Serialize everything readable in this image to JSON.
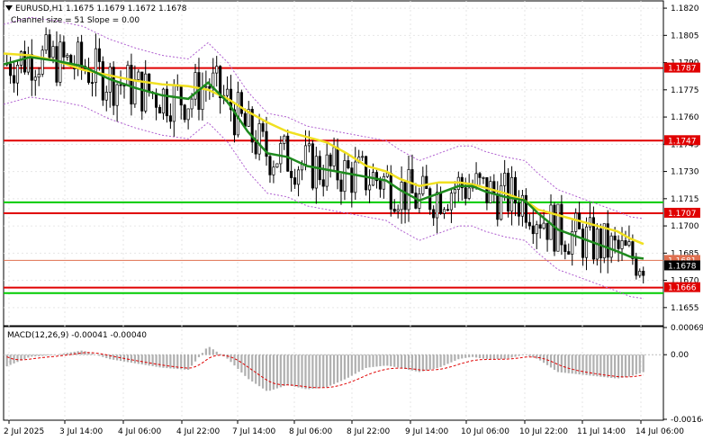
{
  "header": {
    "symbol_line": "EURUSD,H1  1.1675 1.1679 1.1672 1.1678",
    "channel_line": "Channel size = 51 Slope = 0.00"
  },
  "macd": {
    "label": "MACD(12,26,9) -0.00041 -0.00040",
    "axis_ticks": [
      "0.00069",
      "0.00",
      "-0.00164"
    ]
  },
  "chart_data": {
    "type": "candlestick",
    "symbol": "EURUSD",
    "timeframe": "H1",
    "price_axis": {
      "ticks": [
        1.182,
        1.1805,
        1.179,
        1.1775,
        1.176,
        1.1745,
        1.173,
        1.1715,
        1.17,
        1.1685,
        1.167,
        1.1655
      ],
      "ylim": [
        1.1645,
        1.1824
      ]
    },
    "time_axis": {
      "labels": [
        "2 Jul 2025",
        "3 Jul 14:00",
        "4 Jul 06:00",
        "4 Jul 22:00",
        "7 Jul 14:00",
        "8 Jul 06:00",
        "8 Jul 22:00",
        "9 Jul 14:00",
        "10 Jul 06:00",
        "10 Jul 22:00",
        "11 Jul 14:00",
        "14 Jul 06:00"
      ]
    },
    "horizontal_levels": [
      {
        "label": "1.1787",
        "value": 1.1787,
        "color": "#e00000",
        "kind": "resistance"
      },
      {
        "label": "1.1747",
        "value": 1.1747,
        "color": "#e00000",
        "kind": "resistance"
      },
      {
        "value": 1.1713,
        "color": "#00cc00",
        "kind": "support"
      },
      {
        "label": "1.1707",
        "value": 1.1707,
        "color": "#e00000",
        "kind": "resistance"
      },
      {
        "label": "1.1681",
        "value": 1.1681,
        "color": "#e07050",
        "kind": "price"
      },
      {
        "label": "1.1678",
        "value": 1.1678,
        "color": "#000000",
        "kind": "bid"
      },
      {
        "label": "1.1666",
        "value": 1.1666,
        "color": "#e00000",
        "kind": "support"
      },
      {
        "value": 1.1663,
        "color": "#00cc00",
        "kind": "support"
      }
    ],
    "series": [
      {
        "indicator": "fast moving average",
        "color": "#1e8a1e",
        "points": [
          [
            0,
            1.1789
          ],
          [
            0.04,
            1.1793
          ],
          [
            0.08,
            1.1791
          ],
          [
            0.12,
            1.1788
          ],
          [
            0.16,
            1.1781
          ],
          [
            0.2,
            1.1776
          ],
          [
            0.24,
            1.1772
          ],
          [
            0.28,
            1.177
          ],
          [
            0.31,
            1.1779
          ],
          [
            0.34,
            1.1768
          ],
          [
            0.37,
            1.1752
          ],
          [
            0.4,
            1.174
          ],
          [
            0.43,
            1.1738
          ],
          [
            0.46,
            1.1733
          ],
          [
            0.49,
            1.1731
          ],
          [
            0.52,
            1.1729
          ],
          [
            0.55,
            1.1727
          ],
          [
            0.58,
            1.1725
          ],
          [
            0.6,
            1.172
          ],
          [
            0.63,
            1.1714
          ],
          [
            0.66,
            1.1718
          ],
          [
            0.69,
            1.1722
          ],
          [
            0.71,
            1.1722
          ],
          [
            0.73,
            1.1719
          ],
          [
            0.76,
            1.1716
          ],
          [
            0.79,
            1.1714
          ],
          [
            0.81,
            1.1707
          ],
          [
            0.84,
            1.1698
          ],
          [
            0.87,
            1.1694
          ],
          [
            0.9,
            1.169
          ],
          [
            0.93,
            1.1686
          ],
          [
            0.95,
            1.1683
          ],
          [
            0.97,
            1.1682
          ]
        ]
      },
      {
        "indicator": "slow moving average",
        "color": "#f0e020",
        "points": [
          [
            0,
            1.1795
          ],
          [
            0.04,
            1.1794
          ],
          [
            0.08,
            1.1791
          ],
          [
            0.12,
            1.1786
          ],
          [
            0.16,
            1.1783
          ],
          [
            0.2,
            1.178
          ],
          [
            0.24,
            1.1778
          ],
          [
            0.28,
            1.1777
          ],
          [
            0.31,
            1.1775
          ],
          [
            0.34,
            1.177
          ],
          [
            0.37,
            1.1763
          ],
          [
            0.4,
            1.1757
          ],
          [
            0.43,
            1.1752
          ],
          [
            0.46,
            1.1749
          ],
          [
            0.49,
            1.1746
          ],
          [
            0.52,
            1.174
          ],
          [
            0.55,
            1.1733
          ],
          [
            0.58,
            1.173
          ],
          [
            0.6,
            1.1726
          ],
          [
            0.63,
            1.1722
          ],
          [
            0.66,
            1.1724
          ],
          [
            0.69,
            1.1724
          ],
          [
            0.71,
            1.1723
          ],
          [
            0.73,
            1.1721
          ],
          [
            0.76,
            1.1718
          ],
          [
            0.79,
            1.1714
          ],
          [
            0.81,
            1.1709
          ],
          [
            0.84,
            1.1706
          ],
          [
            0.87,
            1.1703
          ],
          [
            0.9,
            1.17
          ],
          [
            0.93,
            1.1697
          ],
          [
            0.95,
            1.1693
          ],
          [
            0.97,
            1.169
          ]
        ]
      }
    ],
    "envelope_color": "#b060d0",
    "candles_color_up": "#000000",
    "candles_color_down": "#000000",
    "gridlines": true
  }
}
